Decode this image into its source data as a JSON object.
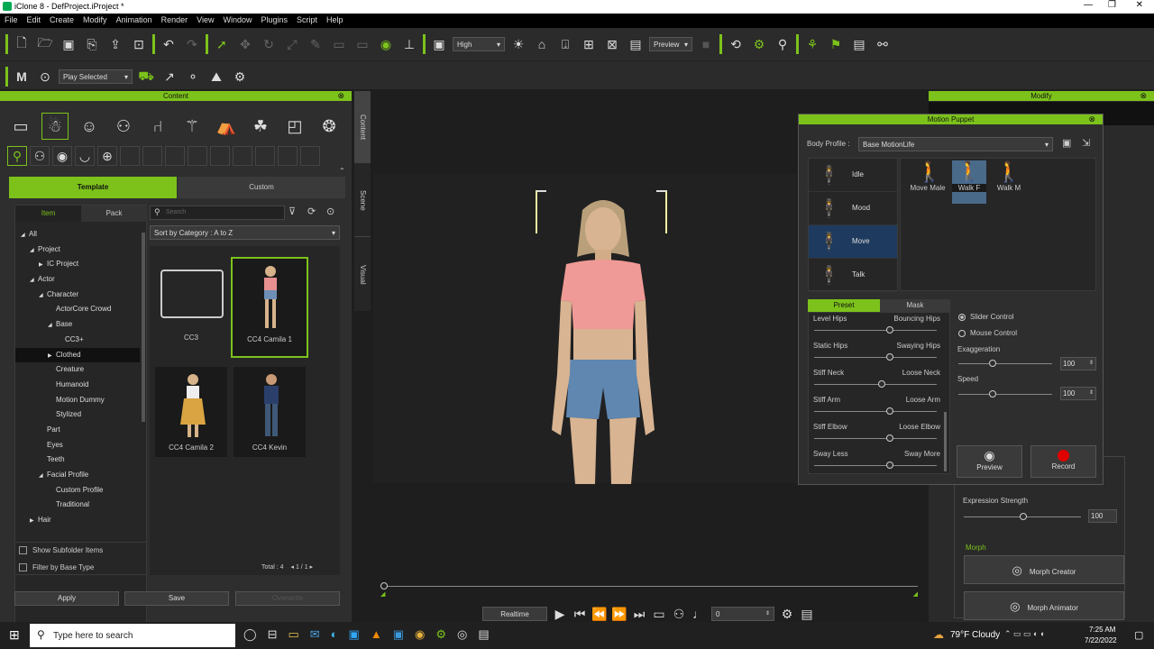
{
  "window": {
    "title": "iClone 8 - DefProject.iProject *"
  },
  "menu": [
    "File",
    "Edit",
    "Create",
    "Modify",
    "Animation",
    "Render",
    "View",
    "Window",
    "Plugins",
    "Script",
    "Help"
  ],
  "toolbar": {
    "quality": "High",
    "preview": "Preview"
  },
  "toolbar2": {
    "play_mode": "Play Selected"
  },
  "content": {
    "header": "Content",
    "tabs": [
      "Template",
      "Custom"
    ],
    "subtabs": [
      "Item",
      "Pack"
    ],
    "search_placeholder": "Search",
    "sort": "Sort by Category : A to Z",
    "tree": [
      {
        "label": "All",
        "indent": 0,
        "arrow": "◢"
      },
      {
        "label": "Project",
        "indent": 1,
        "arrow": "◢"
      },
      {
        "label": "IC Project",
        "indent": 2,
        "arrow": "▶"
      },
      {
        "label": "Actor",
        "indent": 1,
        "arrow": "◢"
      },
      {
        "label": "Character",
        "indent": 2,
        "arrow": "◢"
      },
      {
        "label": "ActorCore Crowd",
        "indent": 3,
        "arrow": ""
      },
      {
        "label": "Base",
        "indent": 3,
        "arrow": "◢"
      },
      {
        "label": "CC3+",
        "indent": 4,
        "arrow": ""
      },
      {
        "label": "Clothed",
        "indent": 3,
        "arrow": "▶"
      },
      {
        "label": "Creature",
        "indent": 3,
        "arrow": ""
      },
      {
        "label": "Humanoid",
        "indent": 3,
        "arrow": ""
      },
      {
        "label": "Motion Dummy",
        "indent": 3,
        "arrow": ""
      },
      {
        "label": "Stylized",
        "indent": 3,
        "arrow": ""
      },
      {
        "label": "Part",
        "indent": 2,
        "arrow": ""
      },
      {
        "label": "Eyes",
        "indent": 2,
        "arrow": ""
      },
      {
        "label": "Teeth",
        "indent": 2,
        "arrow": ""
      },
      {
        "label": "Facial Profile",
        "indent": 2,
        "arrow": "◢"
      },
      {
        "label": "Custom Profile",
        "indent": 3,
        "arrow": ""
      },
      {
        "label": "Traditional",
        "indent": 3,
        "arrow": ""
      },
      {
        "label": "Hair",
        "indent": 1,
        "arrow": "▶"
      }
    ],
    "items": [
      "CC3",
      "CC4 Camila 1",
      "CC4 Camila 2",
      "CC4 Kevin"
    ],
    "show_subfolder": "Show Subfolder Items",
    "filter_base": "Filter by Base Type",
    "total": "Total : 4",
    "page": "1",
    "pages": "1",
    "apply": "Apply",
    "save": "Save",
    "overwrite": "Overwrite"
  },
  "side_tabs": [
    "Content",
    "Scene",
    "Visual"
  ],
  "puppet": {
    "header": "Motion Puppet",
    "body_profile_label": "Body Profile :",
    "body_profile": "Base MotionLife",
    "categories": [
      "Idle",
      "Mood",
      "Move",
      "Talk"
    ],
    "motions": [
      "Move Male",
      "Walk F",
      "Walk M"
    ],
    "tabs": [
      "Preset",
      "Mask"
    ],
    "sliders": [
      {
        "left": "Level Hips",
        "right": "Bouncing Hips",
        "value": 0.62
      },
      {
        "left": "Static Hips",
        "right": "Swaying Hips",
        "value": 0.62
      },
      {
        "left": "Stiff Neck",
        "right": "Loose Neck",
        "value": 0.55
      },
      {
        "left": "Stiff Arm",
        "right": "Loose Arm",
        "value": 0.62
      },
      {
        "left": "Stiff Elbow",
        "right": "Loose Elbow",
        "value": 0.62
      },
      {
        "left": "Sway Less",
        "right": "Sway More",
        "value": 0.62
      }
    ],
    "slider_control": "Slider Control",
    "mouse_control": "Mouse Control",
    "exaggeration": "Exaggeration",
    "exaggeration_value": "100",
    "speed": "Speed",
    "speed_value": "100",
    "preview": "Preview",
    "record": "Record"
  },
  "modify": {
    "header": "Modify",
    "expression_strength": "Expression Strength",
    "expression_value": "100",
    "morph": "Morph",
    "morph_creator": "Morph Creator",
    "morph_animator": "Morph Animator"
  },
  "timeline": {
    "mode": "Realtime",
    "frame": "0"
  },
  "taskbar": {
    "search": "Type here to search",
    "weather": "79°F  Cloudy",
    "time": "7:25 AM",
    "date": "7/22/2022"
  },
  "colors": {
    "accent": "#7cc21b",
    "record": "#e00000"
  }
}
